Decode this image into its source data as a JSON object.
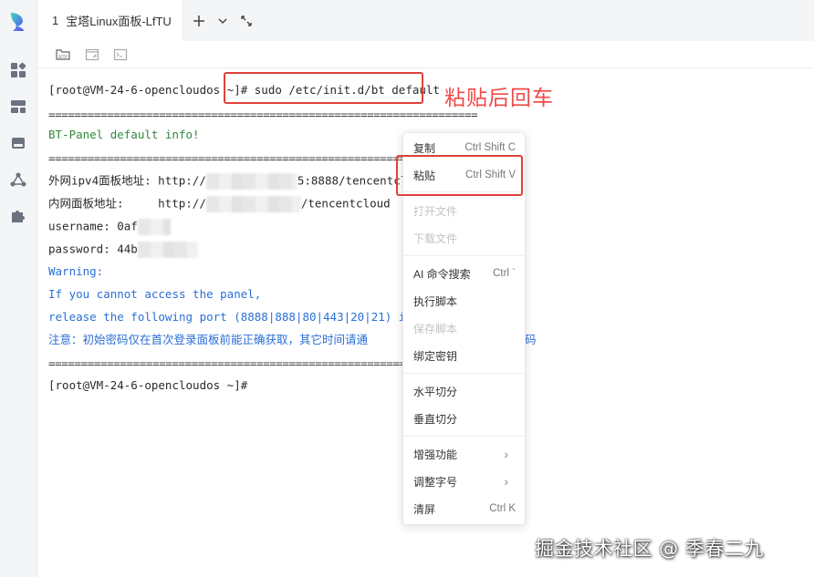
{
  "tab": {
    "number": "1",
    "title": "宝塔Linux面板-LfTU"
  },
  "terminal": {
    "prompt": "[root@VM-24-6-opencloudos ~]",
    "command": "# sudo /etc/init.d/bt default",
    "separator": "==================================================================",
    "info_title": "BT-Panel default info!",
    "ext_label": "外网ipv4面板地址:",
    "ext_prefix": " http://",
    "ext_suffix": "5:8888/tencentcl",
    "int_label": "内网面板地址:",
    "int_prefix": "     http://",
    "int_suffix": "/tencentcloud",
    "username": "username: 0af",
    "password": "password: 44b",
    "warning": "Warning:",
    "warn1": "If you cannot access the panel,",
    "warn2": "release the following port (8888|888|80|443|20|21) in th",
    "note": "注意：初始密码仅在首次登录面板前能正确获取，其它时间请通",
    "note_tail": "码",
    "prompt2": "[root@VM-24-6-opencloudos ~]#"
  },
  "annotation": "粘贴后回车",
  "context_menu": {
    "copy": {
      "label": "复制",
      "shortcut": "Ctrl Shift C"
    },
    "paste": {
      "label": "粘贴",
      "shortcut": "Ctrl Shift V"
    },
    "open_file": {
      "label": "打开文件"
    },
    "download_file": {
      "label": "下载文件"
    },
    "ai_search": {
      "label": "AI 命令搜索",
      "shortcut": "Ctrl `"
    },
    "run_script": {
      "label": "执行脚本"
    },
    "save_script": {
      "label": "保存脚本"
    },
    "bind_key": {
      "label": "绑定密钥"
    },
    "split_h": {
      "label": "水平切分"
    },
    "split_v": {
      "label": "垂直切分"
    },
    "enhance": {
      "label": "增强功能"
    },
    "font_size": {
      "label": "调整字号"
    },
    "clear": {
      "label": "清屏",
      "shortcut": "Ctrl K"
    }
  },
  "watermark": "掘金技术社区 @ 季春二九",
  "colors": {
    "accent_red": "#e0413b",
    "term_green": "#2f8a3c",
    "term_blue": "#2a6fd6"
  }
}
